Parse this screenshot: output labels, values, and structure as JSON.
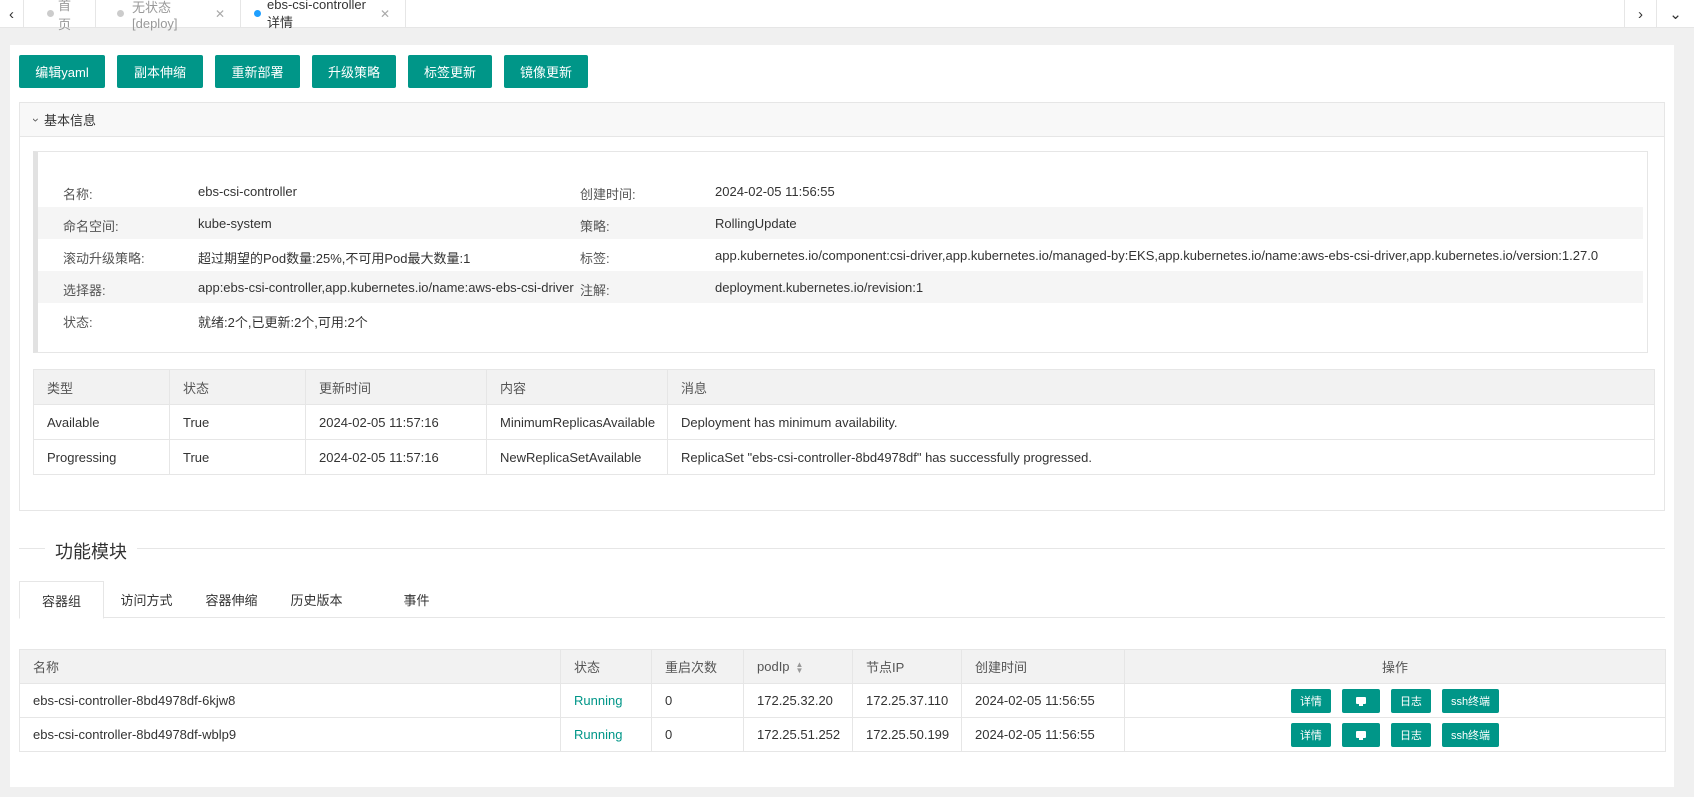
{
  "tabs": [
    {
      "label": "首页",
      "closable": false,
      "active": false
    },
    {
      "label": "无状态[deploy]",
      "closable": true,
      "active": false
    },
    {
      "label": "ebs-csi-controller详情",
      "closable": true,
      "active": true
    }
  ],
  "toolbar": {
    "buttons": [
      "编辑yaml",
      "副本伸缩",
      "重新部署",
      "升级策略",
      "标签更新",
      "镜像更新"
    ]
  },
  "basic_info": {
    "title": "基本信息",
    "rows": [
      {
        "k1": "名称:",
        "v1": "ebs-csi-controller",
        "k2": "创建时间:",
        "v2": "2024-02-05 11:56:55"
      },
      {
        "k1": "命名空间:",
        "v1": "kube-system",
        "k2": "策略:",
        "v2": "RollingUpdate"
      },
      {
        "k1": "滚动升级策略:",
        "v1": "超过期望的Pod数量:25%,不可用Pod最大数量:1",
        "k2": "标签:",
        "v2": "app.kubernetes.io/component:csi-driver,app.kubernetes.io/managed-by:EKS,app.kubernetes.io/name:aws-ebs-csi-driver,app.kubernetes.io/version:1.27.0"
      },
      {
        "k1": "选择器:",
        "v1": "app:ebs-csi-controller,app.kubernetes.io/name:aws-ebs-csi-driver",
        "k2": "注解:",
        "v2": "deployment.kubernetes.io/revision:1"
      },
      {
        "k1": "状态:",
        "v1": "就绪:2个,已更新:2个,可用:2个",
        "k2": "",
        "v2": ""
      }
    ]
  },
  "conditions": {
    "headers": [
      "类型",
      "状态",
      "更新时间",
      "内容",
      "消息"
    ],
    "rows": [
      [
        "Available",
        "True",
        "2024-02-05 11:57:16",
        "MinimumReplicasAvailable",
        "Deployment has minimum availability."
      ],
      [
        "Progressing",
        "True",
        "2024-02-05 11:57:16",
        "NewReplicaSetAvailable",
        "ReplicaSet \"ebs-csi-controller-8bd4978df\" has successfully progressed."
      ]
    ]
  },
  "module_section": {
    "title": "功能模块",
    "tabs": [
      "容器组",
      "访问方式",
      "容器伸缩",
      "历史版本",
      "事件"
    ],
    "active_tab": "容器组"
  },
  "pods": {
    "headers": [
      "名称",
      "状态",
      "重启次数",
      "podIp",
      "节点IP",
      "创建时间",
      "操作"
    ],
    "rows": [
      {
        "name": "ebs-csi-controller-8bd4978df-6kjw8",
        "status": "Running",
        "restarts": "0",
        "pod_ip": "172.25.32.20",
        "node_ip": "172.25.37.110",
        "created": "2024-02-05 11:56:55"
      },
      {
        "name": "ebs-csi-controller-8bd4978df-wblp9",
        "status": "Running",
        "restarts": "0",
        "pod_ip": "172.25.51.252",
        "node_ip": "172.25.50.199",
        "created": "2024-02-05 11:56:55"
      }
    ],
    "actions": {
      "detail": "详情",
      "logs": "日志",
      "ssh": "ssh终端"
    }
  },
  "colors": {
    "accent": "#009688",
    "active_dot": "#1e9fff",
    "running": "#009688"
  },
  "icons": {
    "prev": "chevron-left-icon",
    "next": "chevron-right-icon",
    "menu": "chevron-down-icon",
    "terminal": "terminal-icon",
    "sort": "sort-icon"
  }
}
